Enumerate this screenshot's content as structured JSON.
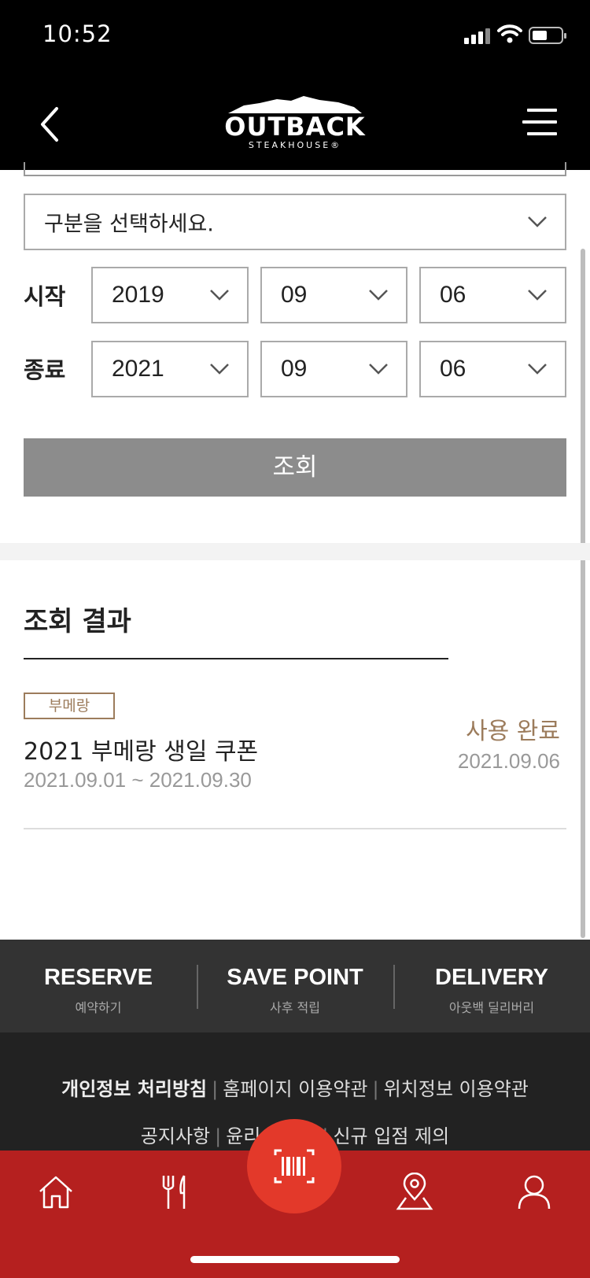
{
  "status_bar": {
    "time": "10:52"
  },
  "header": {
    "logo_main": "OUTBACK",
    "logo_sub": "STEAKHOUSE®"
  },
  "filter": {
    "category": {
      "value": "구분을 선택하세요."
    },
    "start": {
      "label": "시작",
      "year": "2019",
      "month": "09",
      "day": "06"
    },
    "end": {
      "label": "종료",
      "year": "2021",
      "month": "09",
      "day": "06"
    },
    "search_label": "조회"
  },
  "results": {
    "title": "조회 결과",
    "items": [
      {
        "tag": "부메랑",
        "name": "2021 부메랑 생일 쿠폰",
        "period": "2021.09.01 ~ 2021.09.30",
        "status": "사용 완료",
        "used_date": "2021.09.06"
      }
    ]
  },
  "quick_links": [
    {
      "title": "RESERVE",
      "subtitle": "예약하기"
    },
    {
      "title": "SAVE POINT",
      "subtitle": "사후 적립"
    },
    {
      "title": "DELIVERY",
      "subtitle": "아웃백 딜리버리"
    }
  ],
  "footer": {
    "links_row1": [
      "개인정보 처리방침",
      "홈페이지 이용약관",
      "위치정보 이용약관"
    ],
    "links_row2": [
      "공지사항",
      "윤리",
      "신규 입점 제의"
    ]
  },
  "tabbar": {
    "items": [
      "home-icon",
      "restaurant-icon",
      "barcode-icon",
      "location-icon",
      "profile-icon"
    ]
  },
  "colors": {
    "header_bg": "#000000",
    "search_button": "#8c8c8c",
    "accent_brown": "#9c7c5c",
    "tabbar_bg": "#b5201f",
    "scan_button": "#e3392a"
  }
}
